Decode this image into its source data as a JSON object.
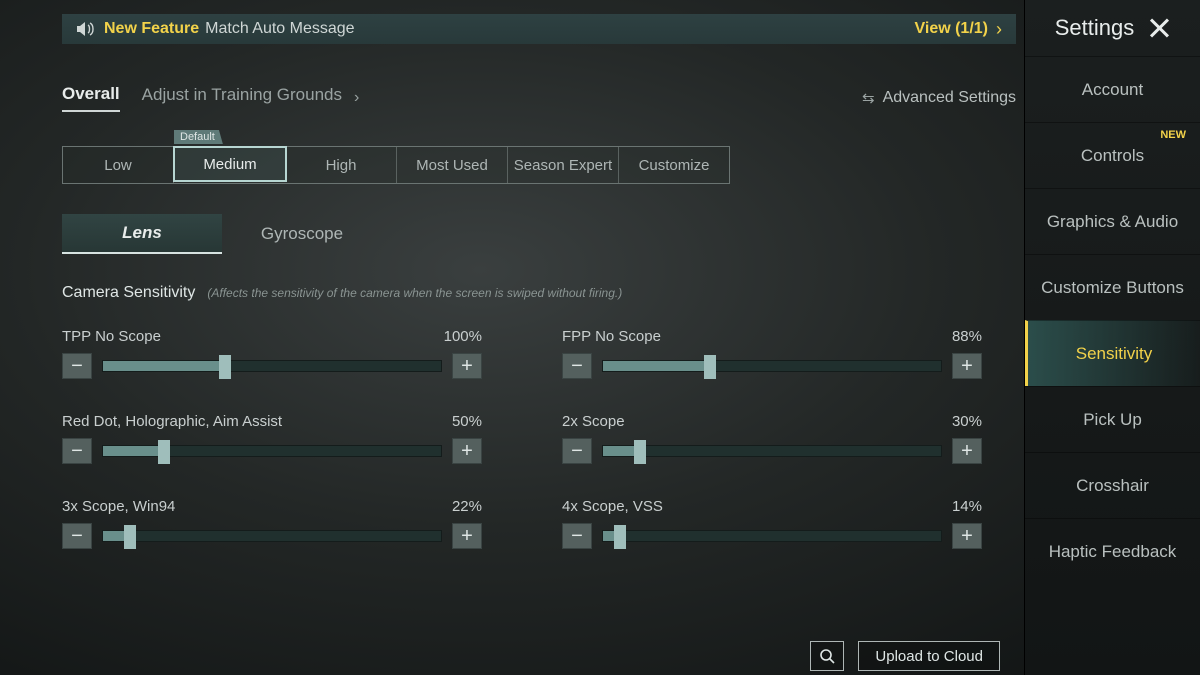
{
  "banner": {
    "feature_prefix": "New Feature",
    "message": "Match Auto Message",
    "view_label": "View (1/1)"
  },
  "sidebar": {
    "title": "Settings",
    "items": [
      {
        "label": "Account",
        "active": false,
        "badge": ""
      },
      {
        "label": "Controls",
        "active": false,
        "badge": "NEW"
      },
      {
        "label": "Graphics & Audio",
        "active": false,
        "badge": ""
      },
      {
        "label": "Customize Buttons",
        "active": false,
        "badge": ""
      },
      {
        "label": "Sensitivity",
        "active": true,
        "badge": ""
      },
      {
        "label": "Pick Up",
        "active": false,
        "badge": ""
      },
      {
        "label": "Crosshair",
        "active": false,
        "badge": ""
      },
      {
        "label": "Haptic Feedback",
        "active": false,
        "badge": ""
      }
    ]
  },
  "subtabs": {
    "overall": "Overall",
    "training": "Adjust in Training Grounds",
    "advanced": "Advanced Settings"
  },
  "presets": {
    "default_tag": "Default",
    "options": [
      "Low",
      "Medium",
      "High",
      "Most Used",
      "Season Expert",
      "Customize"
    ],
    "active_index": 1
  },
  "lg_tabs": {
    "lens": "Lens",
    "gyro": "Gyroscope",
    "active": "lens"
  },
  "section": {
    "title": "Camera Sensitivity",
    "hint": "(Affects the sensitivity of the camera when the screen is swiped without firing.)"
  },
  "sliders": [
    {
      "label": "TPP No Scope",
      "value": 100,
      "display": "100%"
    },
    {
      "label": "FPP No Scope",
      "value": 88,
      "display": "88%"
    },
    {
      "label": "Red Dot, Holographic, Aim Assist",
      "value": 50,
      "display": "50%"
    },
    {
      "label": "2x Scope",
      "value": 30,
      "display": "30%"
    },
    {
      "label": "3x Scope, Win94",
      "value": 22,
      "display": "22%"
    },
    {
      "label": "4x Scope, VSS",
      "value": 14,
      "display": "14%"
    }
  ],
  "bottom": {
    "upload": "Upload to Cloud"
  }
}
